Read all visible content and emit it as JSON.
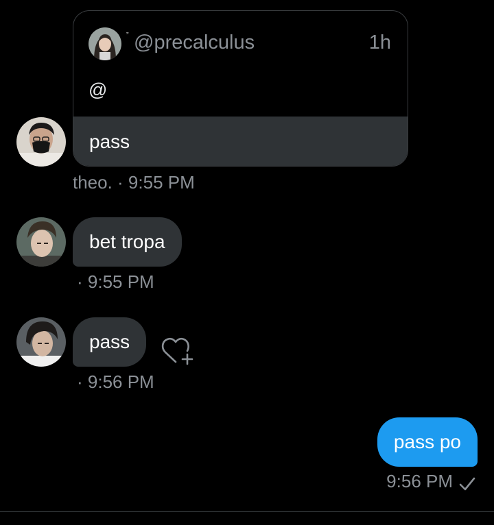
{
  "quote": {
    "handle": "@precalculus",
    "time": "1h",
    "text": "@",
    "mark": "ˮ",
    "reply": "pass"
  },
  "messages": [
    {
      "text": "pass",
      "meta": "theo. · 9:55 PM"
    },
    {
      "text": "bet tropa",
      "meta": "· 9:55 PM"
    },
    {
      "text": "pass",
      "meta": "· 9:56 PM"
    },
    {
      "text": "pass po",
      "meta": "9:56 PM"
    }
  ],
  "icons": {
    "react": "heart-plus-icon",
    "sent": "check-icon"
  },
  "colors": {
    "background": "#000000",
    "received_bubble": "#2f3336",
    "sent_bubble": "#1d9bf0",
    "meta_text": "#8b9096"
  }
}
